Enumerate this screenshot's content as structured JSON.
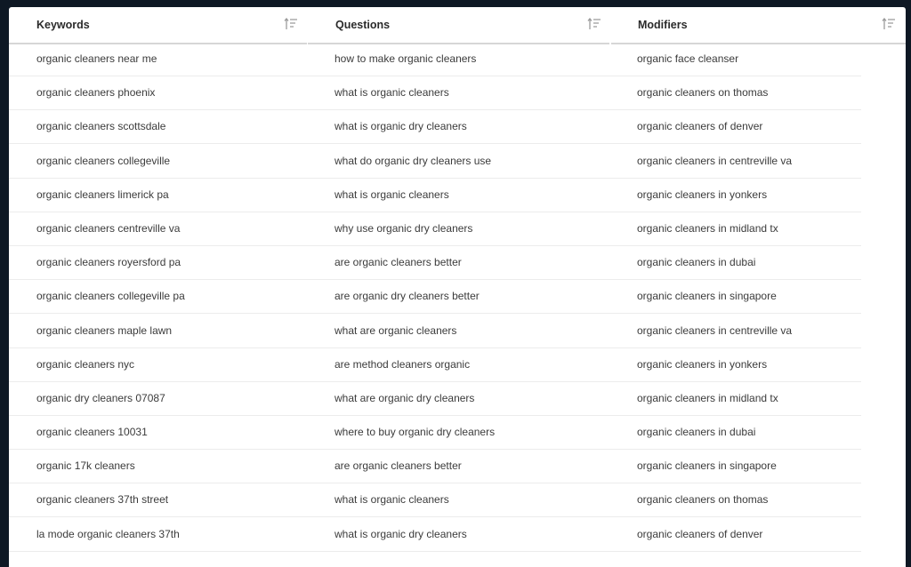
{
  "columns": [
    {
      "label": "Keywords",
      "sort_icon": "sort-icon"
    },
    {
      "label": "Questions",
      "sort_icon": "sort-icon"
    },
    {
      "label": "Modifiers",
      "sort_icon": "sort-icon"
    }
  ],
  "rows": [
    [
      "organic cleaners near me",
      "how to make organic cleaners",
      "organic face cleanser"
    ],
    [
      "organic cleaners phoenix",
      "what is organic cleaners",
      "organic cleaners on thomas"
    ],
    [
      "organic cleaners scottsdale",
      "what is organic dry cleaners",
      "organic cleaners of denver"
    ],
    [
      "organic cleaners collegeville",
      "what do organic dry cleaners use",
      "organic cleaners in centreville va"
    ],
    [
      "organic cleaners limerick pa",
      "what is organic cleaners",
      "organic cleaners in yonkers"
    ],
    [
      "organic cleaners centreville va",
      "why use organic dry cleaners",
      "organic cleaners in midland tx"
    ],
    [
      "organic cleaners royersford pa",
      "are organic cleaners better",
      "organic cleaners in dubai"
    ],
    [
      "organic cleaners collegeville pa",
      "are organic dry cleaners better",
      "organic cleaners in singapore"
    ],
    [
      "organic cleaners maple lawn",
      "what are organic cleaners",
      "organic cleaners in centreville va"
    ],
    [
      "organic cleaners nyc",
      "are method cleaners organic",
      "organic cleaners in yonkers"
    ],
    [
      "organic dry cleaners 07087",
      "what are organic dry cleaners",
      "organic cleaners in midland tx"
    ],
    [
      "organic cleaners 10031",
      "where to buy organic dry cleaners",
      "organic cleaners in dubai"
    ],
    [
      "organic 17k cleaners",
      "are organic cleaners better",
      "organic cleaners in singapore"
    ],
    [
      "organic cleaners 37th street",
      "what is organic cleaners",
      "organic cleaners on thomas"
    ],
    [
      "la mode organic cleaners 37th",
      "what is organic dry cleaners",
      "organic cleaners of denver"
    ]
  ]
}
